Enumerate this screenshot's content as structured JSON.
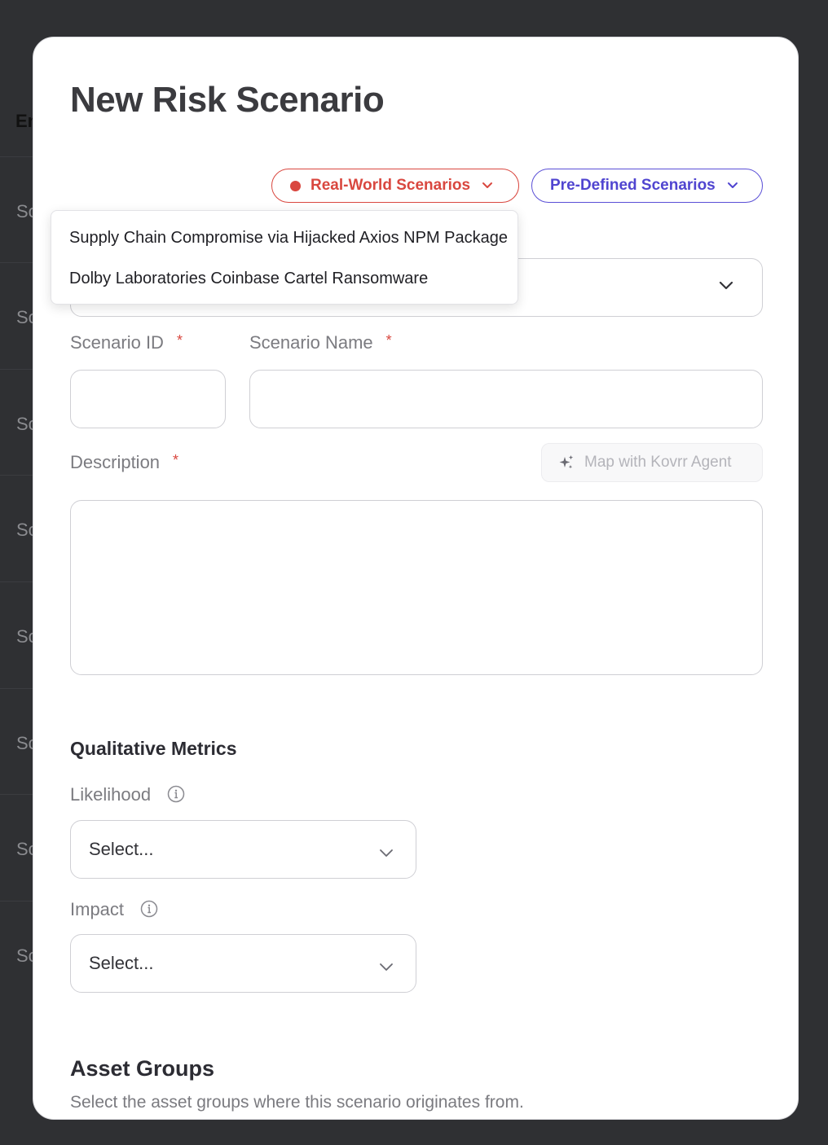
{
  "background": {
    "table_header_partial": "En",
    "row_partial_text": "Sc",
    "row_count": 8
  },
  "modal": {
    "title": "New Risk Scenario",
    "real_world_button": "Real-World Scenarios",
    "predefined_button": "Pre-Defined Scenarios",
    "real_world_menu": {
      "items": [
        "Supply Chain Compromise via Hijacked Axios NPM Package",
        "Dolby Laboratories Coinbase Cartel Ransomware"
      ]
    },
    "scenario_id": {
      "label": "Scenario ID",
      "required_mark": "*",
      "value": ""
    },
    "scenario_name": {
      "label": "Scenario Name",
      "required_mark": "*",
      "value": ""
    },
    "description": {
      "label": "Description",
      "required_mark": "*",
      "value": ""
    },
    "agent_button": "Map with Kovrr Agent",
    "qualitative_metrics": {
      "title": "Qualitative Metrics",
      "likelihood": {
        "label": "Likelihood",
        "value": "Select..."
      },
      "impact": {
        "label": "Impact",
        "value": "Select..."
      }
    },
    "asset_groups": {
      "title": "Asset Groups",
      "subtitle": "Select the asset groups where this scenario originates from."
    }
  },
  "colors": {
    "backdrop": "#2f3033",
    "real_world_accent": "#d9473f",
    "predefined_accent": "#5045d0",
    "required_mark": "#d9473f"
  }
}
